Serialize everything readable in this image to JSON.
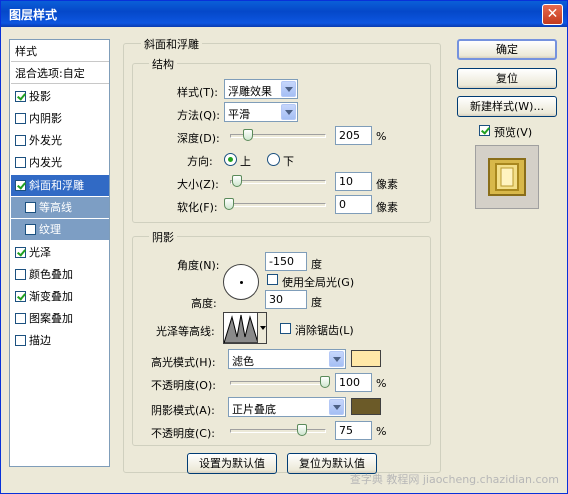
{
  "window": {
    "title": "图层样式",
    "close_glyph": "✕"
  },
  "sidebar": {
    "header": "样式",
    "blend_options": "混合选项:自定",
    "items": [
      {
        "label": "投影",
        "checked": true
      },
      {
        "label": "内阴影",
        "checked": false
      },
      {
        "label": "外发光",
        "checked": false
      },
      {
        "label": "内发光",
        "checked": false
      },
      {
        "label": "斜面和浮雕",
        "checked": true
      },
      {
        "label": "等高线",
        "checked": false
      },
      {
        "label": "纹理",
        "checked": false
      },
      {
        "label": "光泽",
        "checked": true
      },
      {
        "label": "颜色叠加",
        "checked": false
      },
      {
        "label": "渐变叠加",
        "checked": true
      },
      {
        "label": "图案叠加",
        "checked": false
      },
      {
        "label": "描边",
        "checked": false
      }
    ]
  },
  "bevel": {
    "group_title": "斜面和浮雕",
    "structure": {
      "title": "结构",
      "style_label": "样式(T):",
      "style_value": "浮雕效果",
      "technique_label": "方法(Q):",
      "technique_value": "平滑",
      "depth_label": "深度(D):",
      "depth_value": "205",
      "depth_unit": "%",
      "direction_label": "方向:",
      "direction_up": "上",
      "direction_down": "下",
      "size_label": "大小(Z):",
      "size_value": "10",
      "size_unit": "像素",
      "soften_label": "软化(F):",
      "soften_value": "0",
      "soften_unit": "像素"
    },
    "shading": {
      "title": "阴影",
      "angle_label": "角度(N):",
      "angle_value": "-150",
      "angle_unit": "度",
      "global_light_label": "使用全局光(G)",
      "altitude_label": "高度:",
      "altitude_value": "30",
      "altitude_unit": "度",
      "gloss_label": "光泽等高线:",
      "antialias_label": "消除锯齿(L)",
      "highlight_mode_label": "高光模式(H):",
      "highlight_mode_value": "滤色",
      "highlight_color": "#ffe8a8",
      "highlight_opacity_label": "不透明度(O):",
      "highlight_opacity_value": "100",
      "highlight_opacity_unit": "%",
      "shadow_mode_label": "阴影模式(A):",
      "shadow_mode_value": "正片叠底",
      "shadow_color": "#6b5a28",
      "shadow_opacity_label": "不透明度(C):",
      "shadow_opacity_value": "75",
      "shadow_opacity_unit": "%"
    },
    "set_default": "设置为默认值",
    "reset_default": "复位为默认值"
  },
  "buttons": {
    "ok": "确定",
    "reset": "复位",
    "new_style": "新建样式(W)...",
    "preview_label": "预览(V)"
  },
  "watermark": "查字典 教程网 jiaocheng.chazidian.com"
}
